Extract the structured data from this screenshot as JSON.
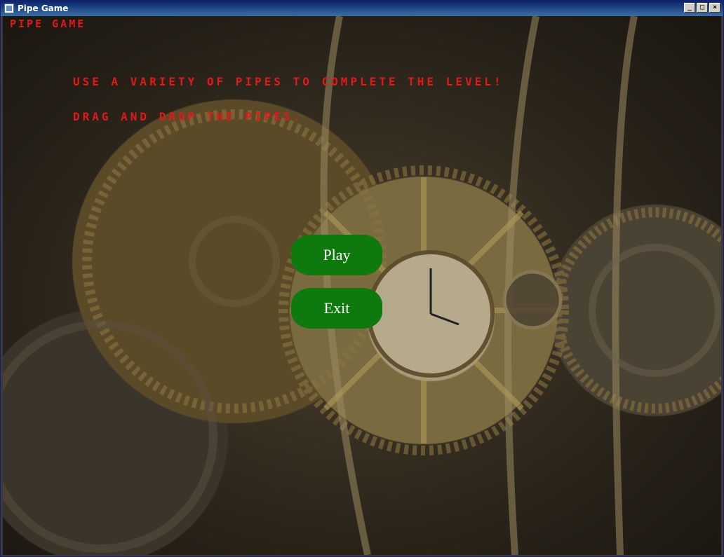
{
  "window": {
    "title": "Pipe Game",
    "controls": {
      "minimize": "_",
      "maximize": "□",
      "close": "×"
    }
  },
  "game": {
    "title": "Pipe Game",
    "instructions": [
      "Use a variety of pipes to complete the level!",
      "Drag and drop the pipes."
    ],
    "buttons": {
      "play": "Play",
      "exit": "Exit"
    }
  },
  "colors": {
    "text_red": "#e01a1a",
    "button_green": "#0e7a0e",
    "titlebar_blue": "#0a246a"
  }
}
